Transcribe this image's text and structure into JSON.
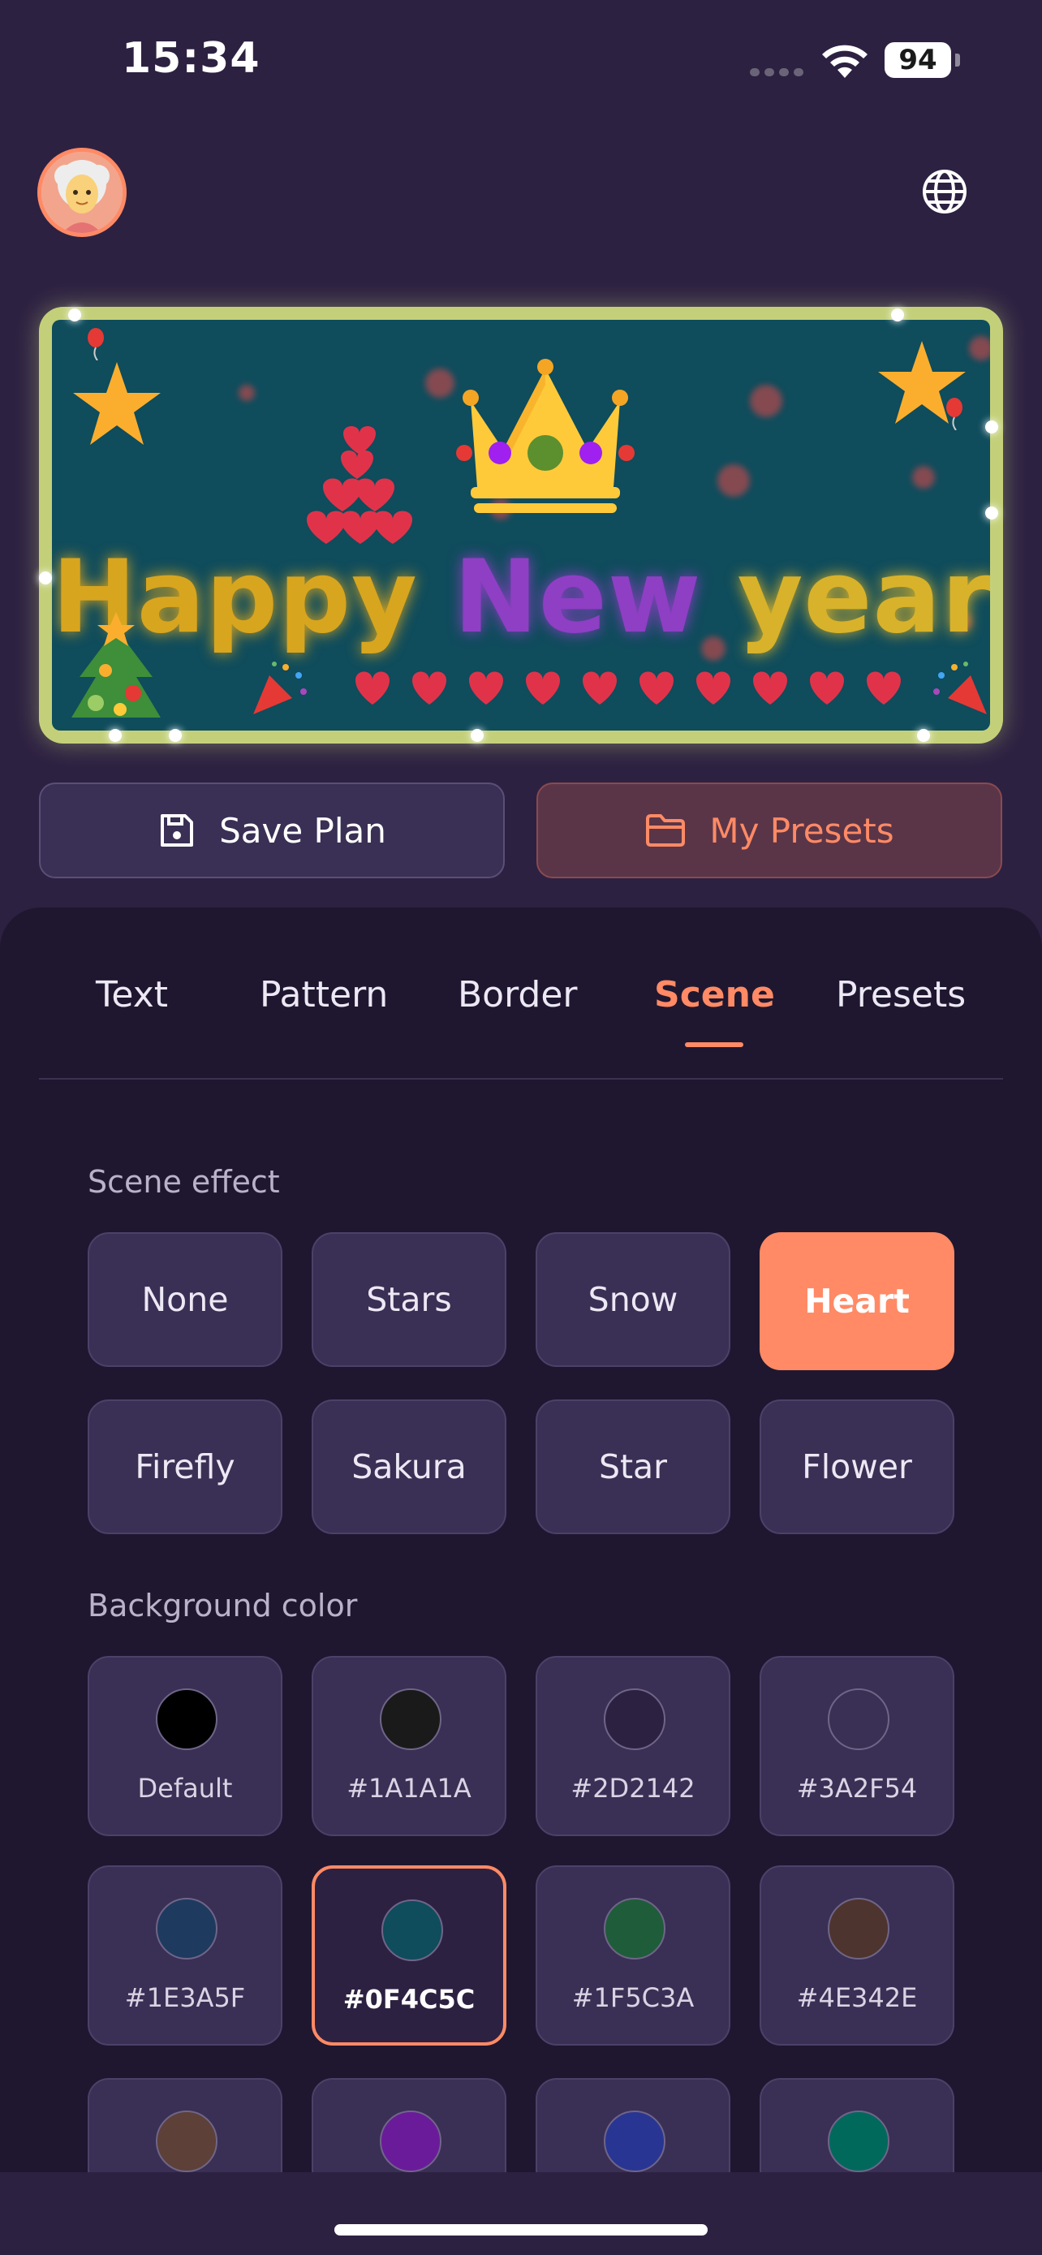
{
  "status_bar": {
    "time": "15:34",
    "battery": "94"
  },
  "banner": {
    "text_words": [
      {
        "text": "Happy",
        "color": "#D6A320"
      },
      {
        "text": "New",
        "color": "#8E3FC4"
      },
      {
        "text": "year",
        "color": "#D8B22A"
      }
    ],
    "background": "#0F4C5C",
    "border_color": "#C4D079"
  },
  "actions": {
    "save_label": "Save Plan",
    "presets_label": "My Presets"
  },
  "tabs": [
    {
      "label": "Text"
    },
    {
      "label": "Pattern"
    },
    {
      "label": "Border"
    },
    {
      "label": "Scene",
      "active": true
    },
    {
      "label": "Presets"
    }
  ],
  "scene": {
    "label": "Scene effect",
    "options": [
      {
        "label": "None"
      },
      {
        "label": "Stars"
      },
      {
        "label": "Snow"
      },
      {
        "label": "Heart",
        "active": true
      },
      {
        "label": "Firefly"
      },
      {
        "label": "Sakura"
      },
      {
        "label": "Star"
      },
      {
        "label": "Flower"
      }
    ]
  },
  "background_color": {
    "label": "Background color",
    "swatches": [
      {
        "name": "Default",
        "color": "#000000"
      },
      {
        "name": "#1A1A1A",
        "color": "#1A1A1A"
      },
      {
        "name": "#2D2142",
        "color": "#2D2142"
      },
      {
        "name": "#3A2F54",
        "color": "#3A2F54"
      },
      {
        "name": "#1E3A5F",
        "color": "#1E3A5F"
      },
      {
        "name": "#0F4C5C",
        "color": "#0F4C5C",
        "selected": true
      },
      {
        "name": "#1F5C3A",
        "color": "#1F5C3A"
      },
      {
        "name": "#4E342E",
        "color": "#4E342E"
      },
      {
        "name": "",
        "color": "#5D4037"
      },
      {
        "name": "",
        "color": "#6A1B9A"
      },
      {
        "name": "",
        "color": "#283593"
      },
      {
        "name": "",
        "color": "#00695C"
      }
    ]
  },
  "colors": {
    "accent": "#FF8A65",
    "page_bg": "#2D2142",
    "sheet_bg": "#1F1730"
  }
}
